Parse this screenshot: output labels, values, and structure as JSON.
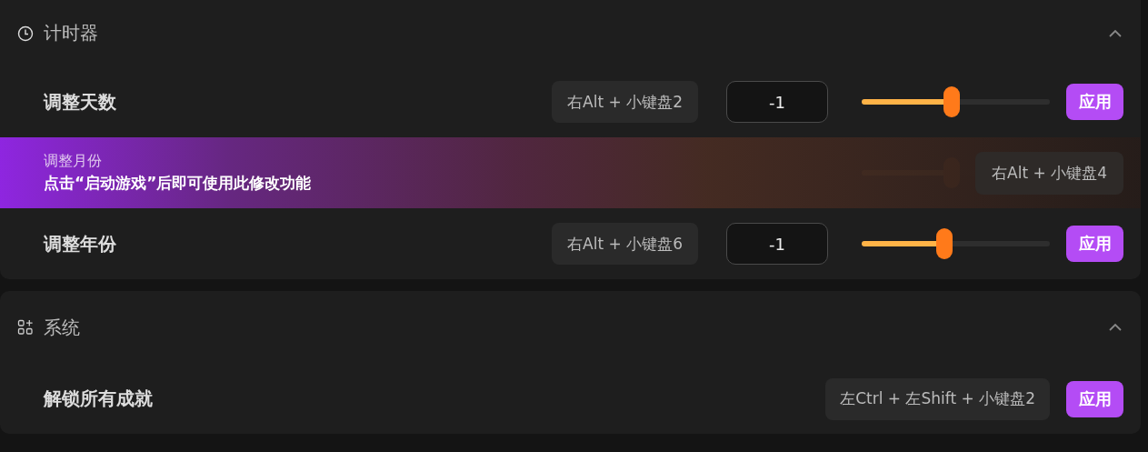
{
  "sections": [
    {
      "title": "计时器",
      "expanded": true,
      "rows": [
        {
          "kind": "slider",
          "label": "调整天数",
          "hotkey": "右Alt + 小键盘2",
          "value": "-1",
          "level": 0.48,
          "button": "应用"
        },
        {
          "kind": "locked",
          "label": "调整月份",
          "notice": "点击“启动游戏”后即可使用此修改功能",
          "level": 0.48,
          "overlay_hotkey": "右Alt + 小键盘4"
        },
        {
          "kind": "slider",
          "label": "调整年份",
          "hotkey": "右Alt + 小键盘6",
          "value": "-1",
          "level": 0.44,
          "button": "应用"
        }
      ]
    },
    {
      "title": "系统",
      "expanded": true,
      "rows": [
        {
          "kind": "hotkey",
          "label": "解锁所有成就",
          "hotkey": "左Ctrl + 左Shift + 小键盘2",
          "button": "应用"
        }
      ]
    }
  ]
}
